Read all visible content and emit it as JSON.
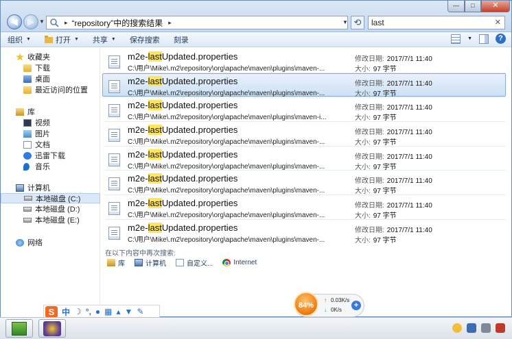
{
  "window": {
    "address": {
      "path_text": "“repository”中的搜索结果",
      "chevron": "▸"
    },
    "search": {
      "value": "last"
    },
    "controls": {
      "minimize": "—",
      "maximize": "□",
      "close": "✕"
    }
  },
  "toolbar": {
    "items": [
      {
        "label": "组织",
        "has_caret": true
      },
      {
        "label": "打开",
        "has_caret": true
      },
      {
        "label": "共享",
        "has_caret": true
      },
      {
        "label": "保存搜索",
        "has_caret": false
      },
      {
        "label": "刻录",
        "has_caret": false
      }
    ],
    "help_label": "?"
  },
  "sidebar": {
    "favorites": {
      "label": "收藏夹",
      "items": [
        "下载",
        "桌面",
        "最近访问的位置"
      ]
    },
    "libraries": {
      "label": "库",
      "items": [
        "视频",
        "图片",
        "文档",
        "迅雷下载",
        "音乐"
      ]
    },
    "computer": {
      "label": "计算机",
      "items": [
        "本地磁盘 (C:)",
        "本地磁盘 (D:)",
        "本地磁盘 (E:)"
      ],
      "selected_index": 0
    },
    "network": {
      "label": "网络"
    }
  },
  "results": {
    "name_prefix": "m2e-",
    "name_highlight": "last",
    "name_suffix": "Updated.properties",
    "date_label": "修改日期:",
    "size_label": "大小:",
    "selected_index": 1,
    "rows": [
      {
        "path": "C:\\用户\\Mike\\.m2\\repository\\org\\apache\\maven\\plugins\\maven-...",
        "date": "2017/7/1 11:40",
        "size": "97 字节"
      },
      {
        "path": "C:\\用户\\Mike\\.m2\\repository\\org\\apache\\maven\\plugins\\maven-...",
        "date": "2017/7/1 11:40",
        "size": "97 字节"
      },
      {
        "path": "C:\\用户\\Mike\\.m2\\repository\\org\\apache\\maven\\plugins\\maven-i...",
        "date": "2017/7/1 11:40",
        "size": "97 字节"
      },
      {
        "path": "C:\\用户\\Mike\\.m2\\repository\\org\\apache\\maven\\plugins\\maven-...",
        "date": "2017/7/1 11:40",
        "size": "97 字节"
      },
      {
        "path": "C:\\用户\\Mike\\.m2\\repository\\org\\apache\\maven\\plugins\\maven-...",
        "date": "2017/7/1 11:40",
        "size": "97 字节"
      },
      {
        "path": "C:\\用户\\Mike\\.m2\\repository\\org\\apache\\maven\\plugins\\maven-...",
        "date": "2017/7/1 11:40",
        "size": "97 字节"
      },
      {
        "path": "C:\\用户\\Mike\\.m2\\repository\\org\\apache\\maven\\plugins\\maven-...",
        "date": "2017/7/1 11:40",
        "size": "97 字节"
      },
      {
        "path": "C:\\用户\\Mike\\.m2\\repository\\org\\apache\\maven\\plugins\\maven-...",
        "date": "2017/7/1 11:40",
        "size": "97 字节"
      }
    ]
  },
  "search_again": {
    "label": "在以下内容中再次搜索:",
    "locations": [
      "库",
      "计算机",
      "自定义...",
      "Internet"
    ]
  },
  "ime": {
    "logo": "S",
    "mode": "中"
  },
  "speed_widget": {
    "percent": "84%",
    "up": "0.03K/s",
    "down": "0K/s",
    "plus": "+"
  },
  "colors": {
    "highlight": "#ffe55c",
    "selection": "#cde1f6",
    "accent": "#2f6fc3"
  }
}
